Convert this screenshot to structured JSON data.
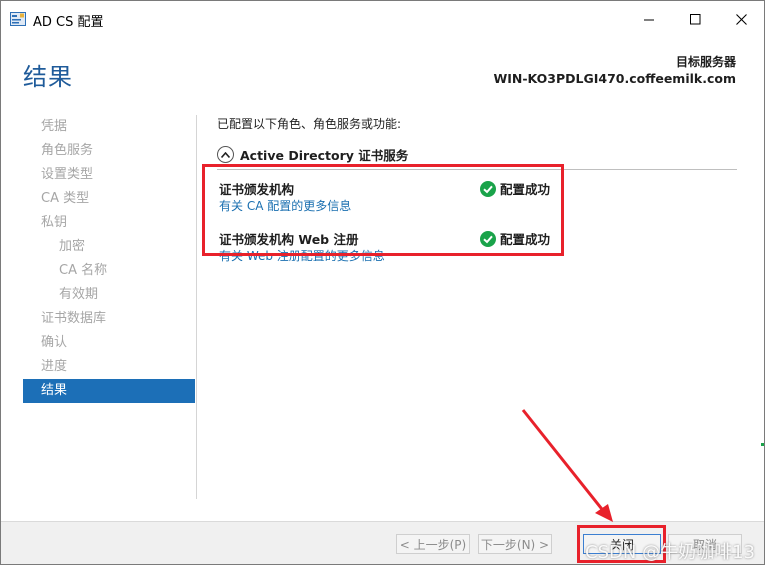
{
  "window": {
    "title": "AD CS 配置",
    "controls": {
      "minimize": "minimize-icon",
      "maximize": "maximize-icon",
      "close": "close-icon"
    }
  },
  "header": {
    "page_title": "结果",
    "target_label": "目标服务器",
    "target_value": "WIN-KO3PDLGI470.coffeemilk.com"
  },
  "nav": {
    "items": [
      {
        "label": "凭据",
        "level": 0,
        "active": false
      },
      {
        "label": "角色服务",
        "level": 0,
        "active": false
      },
      {
        "label": "设置类型",
        "level": 0,
        "active": false
      },
      {
        "label": "CA 类型",
        "level": 0,
        "active": false
      },
      {
        "label": "私钥",
        "level": 0,
        "active": false
      },
      {
        "label": "加密",
        "level": 1,
        "active": false
      },
      {
        "label": "CA 名称",
        "level": 1,
        "active": false
      },
      {
        "label": "有效期",
        "level": 1,
        "active": false
      },
      {
        "label": "证书数据库",
        "level": 0,
        "active": false
      },
      {
        "label": "确认",
        "level": 0,
        "active": false
      },
      {
        "label": "进度",
        "level": 0,
        "active": false
      },
      {
        "label": "结果",
        "level": 0,
        "active": true
      }
    ]
  },
  "content": {
    "intro": "已配置以下角色、角色服务或功能:",
    "section_title": "Active Directory 证书服务",
    "results": [
      {
        "role": "证书颁发机构",
        "link": "有关 CA 配置的更多信息",
        "status": "配置成功"
      },
      {
        "role": "证书颁发机构 Web 注册",
        "link": "有关 Web 注册配置的更多信息",
        "status": "配置成功"
      }
    ]
  },
  "footer": {
    "prev": "< 上一步(P)",
    "next": "下一步(N) >",
    "close": "关闭",
    "cancel": "取消"
  },
  "colors": {
    "accent": "#1c6fb7",
    "success": "#1aa34a",
    "highlight": "#e8212b",
    "title_blue": "#1f5b9a"
  },
  "watermark": "CSDN @牛奶咖啡13"
}
